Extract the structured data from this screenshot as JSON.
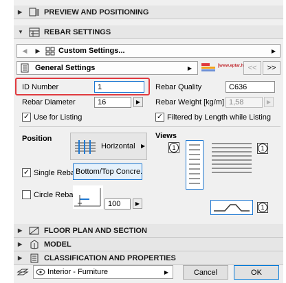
{
  "sections": {
    "preview": "PREVIEW AND POSITIONING",
    "rebar_settings": "REBAR SETTINGS",
    "floor_plan": "FLOOR PLAN AND SECTION",
    "model": "MODEL",
    "classification": "CLASSIFICATION AND PROPERTIES"
  },
  "nav": {
    "custom_settings": "Custom Settings..."
  },
  "general": {
    "label": "General Settings",
    "logo_text": "[www.eptar.hu]",
    "prev": "<<",
    "next": ">>"
  },
  "fields": {
    "id_number_label": "ID Number",
    "id_number_value": "1",
    "rebar_quality_label": "Rebar Quality",
    "rebar_quality_value": "C636",
    "rebar_diameter_label": "Rebar Diameter",
    "rebar_diameter_value": "16",
    "rebar_weight_label": "Rebar Weight [kg/m]",
    "rebar_weight_value": "1,58"
  },
  "checks": {
    "use_for_listing": "Use for Listing",
    "filtered_by_length": "Filtered by Length while Listing",
    "single_rebar": "Single Rebar",
    "circle_rebar": "Circle Rebar"
  },
  "position": {
    "label": "Position",
    "orientation": "Horizontal",
    "placement": "Bottom/Top Concre...",
    "distance": "100"
  },
  "views": {
    "label": "Views",
    "num1": "1",
    "num2": "1",
    "num3": "1"
  },
  "footer": {
    "layer": "Interior - Furniture",
    "cancel": "Cancel",
    "ok": "OK"
  },
  "colors": {
    "highlight": "#e0393e",
    "selected_blue": "#1e78d2",
    "panel": "#f0f0f0"
  }
}
